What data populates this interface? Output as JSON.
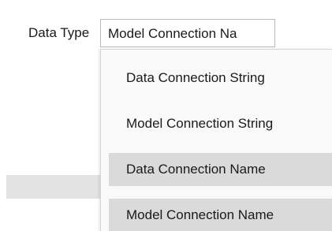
{
  "form": {
    "data_type_label": "Data Type",
    "data_type_value": "Model Connection Na"
  },
  "dropdown": {
    "options": [
      {
        "label": "Data Connection String"
      },
      {
        "label": "Model Connection String"
      },
      {
        "label": "Data Connection Name"
      },
      {
        "label": "Model Connection Name"
      }
    ],
    "highlight_color": "#dadada"
  }
}
